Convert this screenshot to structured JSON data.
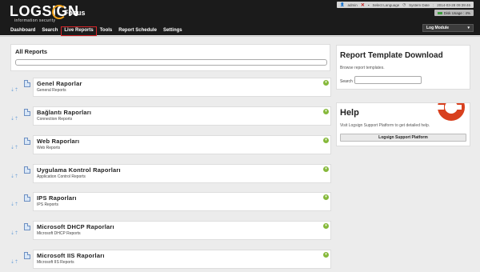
{
  "app": {
    "logo_text": "LOGSIGN",
    "logo_tagline": "information security",
    "product": "Focus"
  },
  "nav": [
    {
      "label": "Dashboard",
      "active": false
    },
    {
      "label": "Search",
      "active": false
    },
    {
      "label": "Live Reports",
      "active": true
    },
    {
      "label": "Tools",
      "active": false
    },
    {
      "label": "Report Schedule",
      "active": false
    },
    {
      "label": "Settings",
      "active": false
    }
  ],
  "status": {
    "user": "admin",
    "language_label": "Select Language",
    "date_label": "System Date",
    "date_value": "2014-03-28 09:39:46",
    "disk_label": "Disk Usage",
    "disk_value": "4%"
  },
  "log_module": {
    "label": "Log Module"
  },
  "all_reports": {
    "title": "All Reports",
    "search_value": ""
  },
  "categories": [
    {
      "title": "Genel Raporlar",
      "subtitle": "General Reports"
    },
    {
      "title": "Bağlantı Raporları",
      "subtitle": "Connection Reports"
    },
    {
      "title": "Web Raporları",
      "subtitle": "Web Reports"
    },
    {
      "title": "Uygulama Kontrol Raporları",
      "subtitle": "Application Control Reports"
    },
    {
      "title": "IPS Raporları",
      "subtitle": "IPS Reports"
    },
    {
      "title": "Microsoft DHCP Raporları",
      "subtitle": "Microsoft DHCP Reports"
    },
    {
      "title": "Microsoft IIS Raporları",
      "subtitle": "Microsoft IIS Reports"
    }
  ],
  "report_template": {
    "title": "Report Template Download",
    "description": "Browse report templates.",
    "search_label": "Search :",
    "search_value": ""
  },
  "help": {
    "title": "Help",
    "description": "Visit Logsign Support Platform to get detailed help.",
    "button_label": "Logsign Support Platform"
  },
  "colors": {
    "topbar": "#1b1b1b",
    "active_nav_border": "#d8262a",
    "toggle_green": "#86b93b",
    "buoy": "#d8401e",
    "page_bg": "#ececec"
  }
}
